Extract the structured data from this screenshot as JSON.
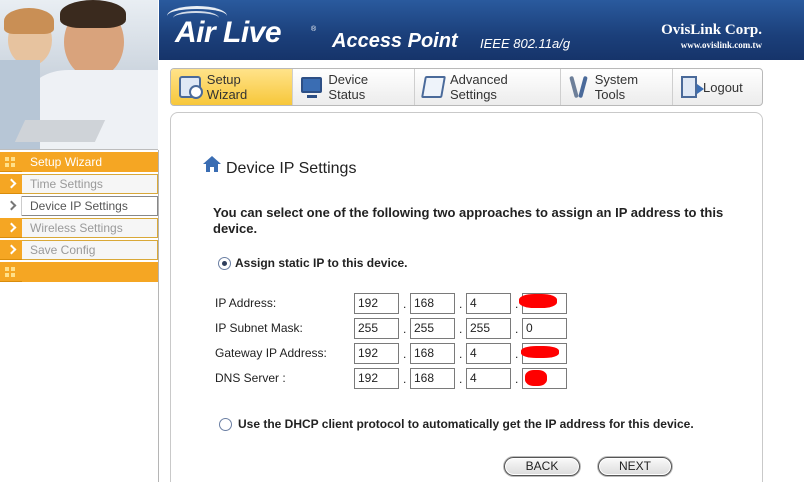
{
  "header": {
    "brand": "Air Live",
    "brand_mark": "®",
    "product": "Access Point",
    "standard": "IEEE 802.11a/g",
    "company": "OvisLink Corp.",
    "company_url": "www.ovislink.com.tw"
  },
  "nav": {
    "tabs": [
      {
        "label": "Setup Wizard",
        "icon": "wizard-icon",
        "active": true
      },
      {
        "label": "Device Status",
        "icon": "monitor-icon",
        "active": false
      },
      {
        "label": "Advanced Settings",
        "icon": "book-icon",
        "active": false
      },
      {
        "label": "System Tools",
        "icon": "tools-icon",
        "active": false
      },
      {
        "label": "Logout",
        "icon": "logout-icon",
        "active": false
      }
    ]
  },
  "sidebar": {
    "header": "Setup Wizard",
    "items": [
      {
        "label": "Time Settings",
        "active": false
      },
      {
        "label": "Device IP Settings",
        "active": true
      },
      {
        "label": "Wireless Settings",
        "active": false
      },
      {
        "label": "Save Config",
        "active": false
      }
    ]
  },
  "main": {
    "title": "Device IP Settings",
    "intro": "You can select one of the following two approaches to assign an IP address to this device.",
    "option_static": "Assign static IP to this device.",
    "option_dhcp": "Use the DHCP client protocol to automatically get the IP address for this device.",
    "static_selected": true,
    "fields": [
      {
        "label": "IP Address:",
        "octets": [
          "192",
          "168",
          "4",
          ""
        ],
        "redacted_last": true
      },
      {
        "label": "IP Subnet Mask:",
        "octets": [
          "255",
          "255",
          "255",
          "0"
        ],
        "redacted_last": false
      },
      {
        "label": "Gateway IP Address:",
        "octets": [
          "192",
          "168",
          "4",
          ""
        ],
        "redacted_last": true
      },
      {
        "label": "DNS Server :",
        "octets": [
          "192",
          "168",
          "4",
          ""
        ],
        "redacted_last": true
      }
    ],
    "back_label": "BACK",
    "next_label": "NEXT"
  },
  "colors": {
    "banner": "#1b3f7a",
    "accent_orange": "#f5a623",
    "active_tab": "#f7c73a",
    "redaction": "#ff0000"
  }
}
